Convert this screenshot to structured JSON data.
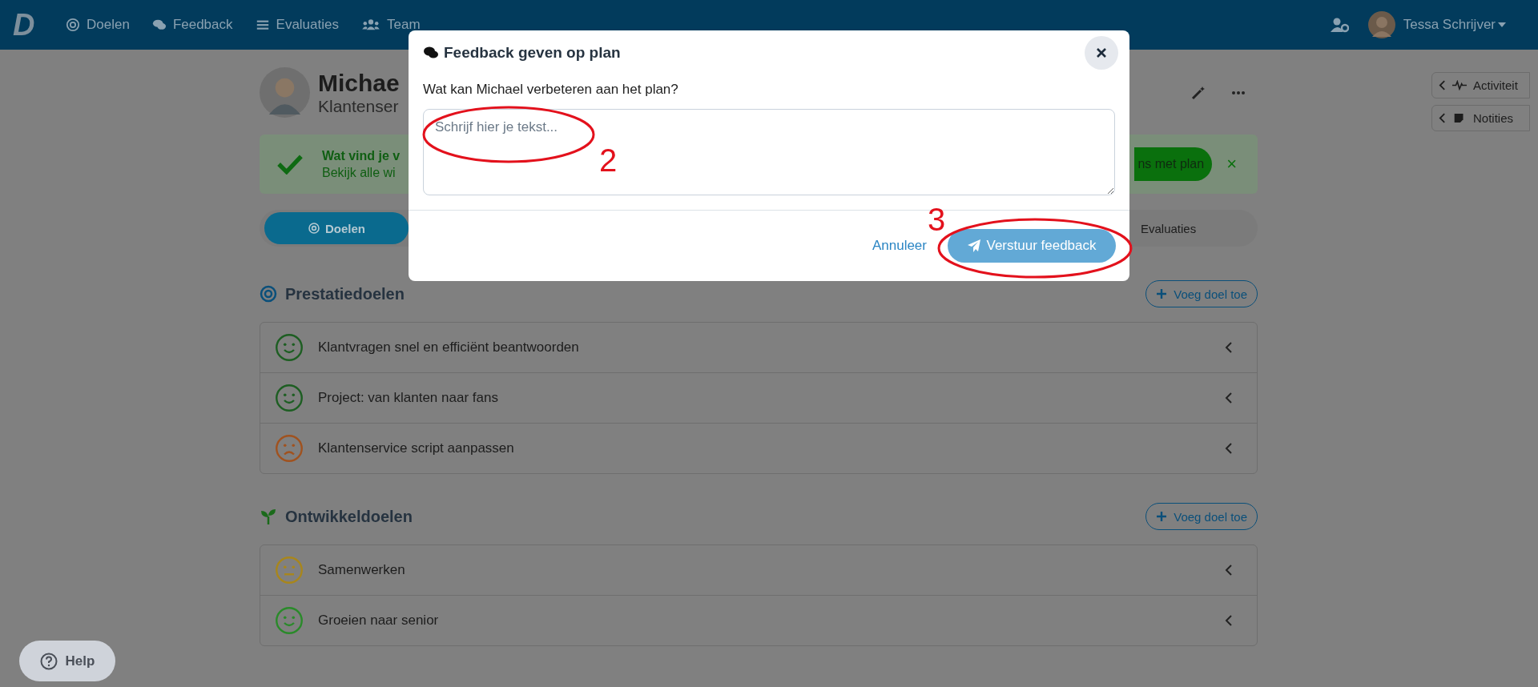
{
  "nav": {
    "logo": "D",
    "items": [
      "Doelen",
      "Feedback",
      "Evaluaties",
      "Team"
    ],
    "user": "Tessa Schrijver"
  },
  "side_panel": [
    "Activiteit",
    "Notities"
  ],
  "profile": {
    "name": "Michae",
    "role": "Klantenser"
  },
  "banner": {
    "title": "Wat vind je v",
    "text": "Bekijk alle wi",
    "action": "ns met plan",
    "close": "×"
  },
  "tabs": [
    {
      "label": "Doelen",
      "selected": true
    },
    {
      "label": "Evaluaties",
      "selected": false
    }
  ],
  "sections": [
    {
      "title": "Prestatiedoelen",
      "add": "Voeg doel toe",
      "goals": [
        {
          "title": "Klantvragen snel en efficiënt beantwoorden",
          "kind": "happy",
          "color": "#1d5e22"
        },
        {
          "title": "Project: van klanten naar fans",
          "kind": "happy",
          "color": "#1d5e22"
        },
        {
          "title": "Klantenservice script aanpassen",
          "kind": "sad",
          "color": "#a0521f"
        }
      ]
    },
    {
      "title": "Ontwikkeldoelen",
      "add": "Voeg doel toe",
      "goals": [
        {
          "title": "Samenwerken",
          "kind": "neutral",
          "color": "#a8861c"
        },
        {
          "title": "Groeien naar senior",
          "kind": "happy",
          "color": "#2a8a2a"
        }
      ]
    }
  ],
  "modal": {
    "title": "Feedback geven op plan",
    "question": "Wat kan Michael verbeteren aan het plan?",
    "placeholder": "Schrijf hier je tekst...",
    "cancel": "Annuleer",
    "submit": "Verstuur feedback"
  },
  "annotations": [
    "2",
    "3"
  ],
  "help": "Help"
}
